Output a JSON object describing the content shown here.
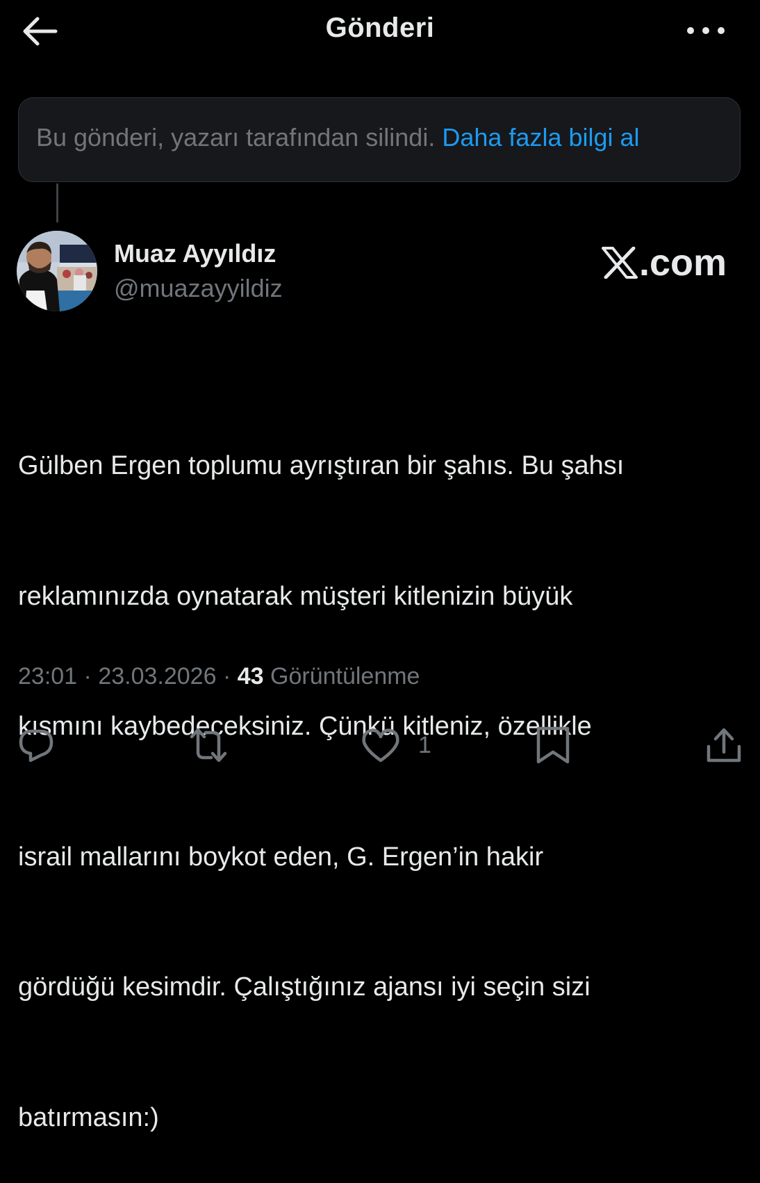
{
  "header": {
    "title": "Gönderi"
  },
  "deleted_notice": {
    "text": "Bu gönderi, yazarı tarafından silindi.",
    "link": "Daha fazla bilgi al"
  },
  "author": {
    "name": "Muaz Ayyıldız",
    "handle": "@muazayyildiz"
  },
  "watermark": {
    "text": ".com"
  },
  "tweet": {
    "lines": [
      "Gülben Ergen toplumu ayrıştıran bir şahıs. Bu şahsı",
      "reklamınızda oynatarak müşteri kitlenizin büyük",
      "kısmını kaybedeceksiniz. Çünkü kitleniz, özellikle",
      "israil mallarını boykot eden, G. Ergen’in hakir",
      "gördüğü kesimdir. Çalıştığınız ajansı iyi seçin sizi",
      "batırmasın:)"
    ]
  },
  "meta": {
    "time": "23:01",
    "date": "23.03.2026",
    "separator": "·",
    "views_count": "43",
    "views_label": "Görüntülenme"
  },
  "actions": {
    "like_count": "1"
  },
  "colors": {
    "background": "#000000",
    "text_primary": "#e7e9ea",
    "text_secondary": "#71767b",
    "link": "#1d9bf0",
    "notice_bg": "#16181c"
  }
}
